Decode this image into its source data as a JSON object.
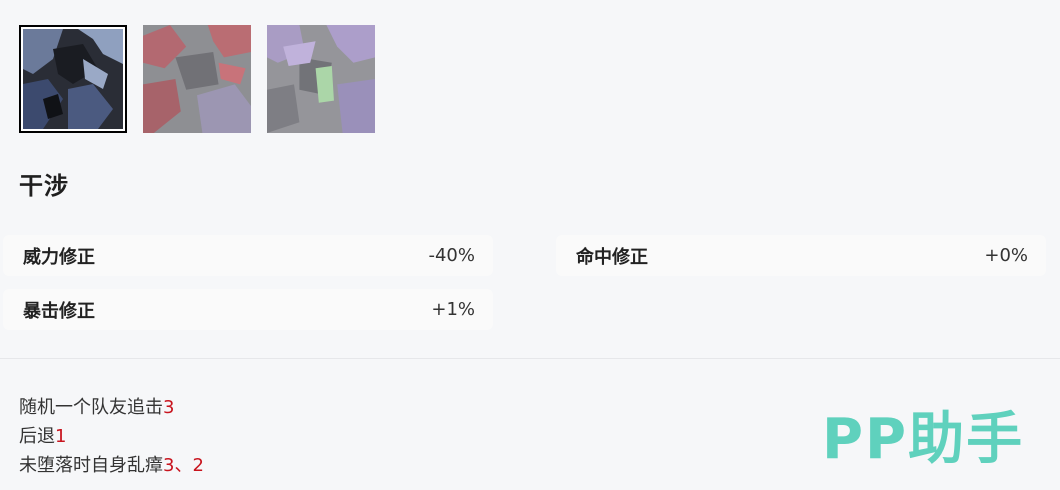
{
  "thumbnails": [
    {
      "name": "thumb-1",
      "selected": true
    },
    {
      "name": "thumb-2",
      "selected": false
    },
    {
      "name": "thumb-3",
      "selected": false
    }
  ],
  "skill": {
    "title": "干涉"
  },
  "stats": [
    {
      "label": "威力修正",
      "value": "-40%"
    },
    {
      "label": "命中修正",
      "value": "+0%"
    },
    {
      "label": "暴击修正",
      "value": "+1%"
    }
  ],
  "effects": [
    {
      "text": "随机一个队友追击",
      "num": "3"
    },
    {
      "text": "后退",
      "num": "1"
    },
    {
      "text": "未堕落时自身乱瘴",
      "num": "3、2"
    }
  ],
  "logo": {
    "text": "PP助手",
    "color": "#5fd1bd"
  },
  "colors": {
    "highlight": "#c8141e",
    "background": "#f6f7f9"
  }
}
